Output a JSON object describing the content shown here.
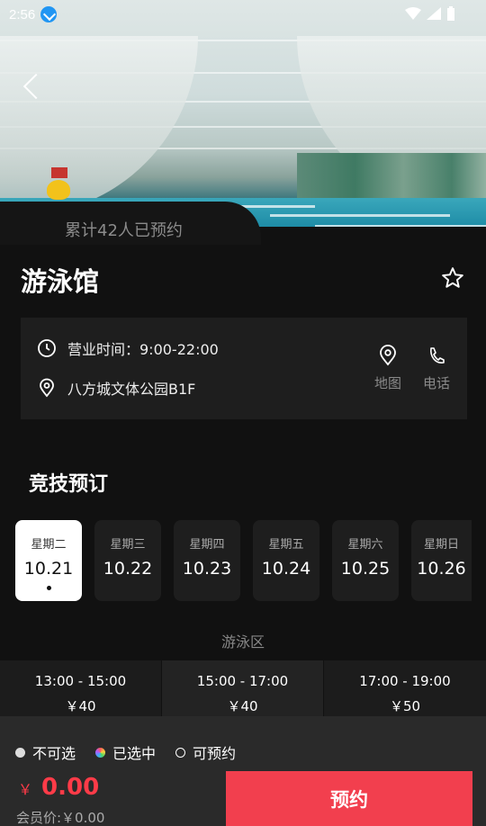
{
  "status": {
    "time": "2:56"
  },
  "hero": {
    "booked_count_text": "累计42人已预约"
  },
  "venue": {
    "title": "游泳馆",
    "hours": "营业时间：9:00-22:00",
    "address": "八方城文体公园B1F",
    "map_label": "地图",
    "phone_label": "电话"
  },
  "section_title": "竞技预订",
  "days": [
    {
      "weekday": "星期二",
      "date": "10.21"
    },
    {
      "weekday": "星期三",
      "date": "10.22"
    },
    {
      "weekday": "星期四",
      "date": "10.23"
    },
    {
      "weekday": "星期五",
      "date": "10.24"
    },
    {
      "weekday": "星期六",
      "date": "10.25"
    },
    {
      "weekday": "星期日",
      "date": "10.26"
    }
  ],
  "zone_label": "游泳区",
  "slots": [
    {
      "time": "13:00 - 15:00",
      "price": "￥40"
    },
    {
      "time": "15:00 - 17:00",
      "price": "￥40"
    },
    {
      "time": "17:00 - 19:00",
      "price": "￥50"
    }
  ],
  "legend": {
    "unavailable": "不可选",
    "selected": "已选中",
    "available": "可预约"
  },
  "footer": {
    "currency": "￥",
    "amount": "0.00",
    "member_price": "会员价:￥0.00",
    "book_button": "预约"
  },
  "colors": {
    "accent": "#f23f4e",
    "price": "#ff3b48",
    "background": "#111111"
  }
}
